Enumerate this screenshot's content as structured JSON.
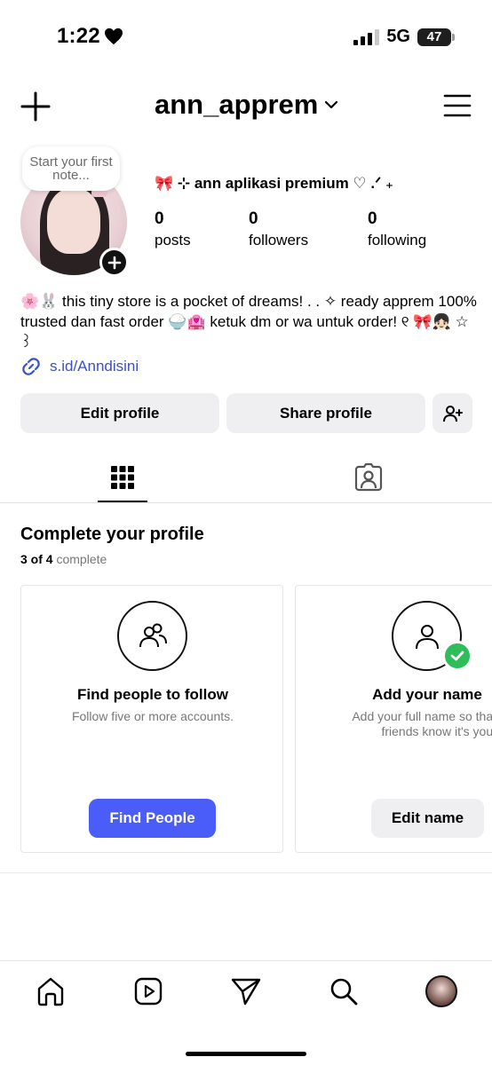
{
  "status_bar": {
    "time": "1:22",
    "network": "5G",
    "battery": "47"
  },
  "header": {
    "username": "ann_apprem"
  },
  "profile": {
    "note": "Start your first note...",
    "display_name": "🎀 ⊹ ann aplikasi premium ♡ .ᐟ ₊",
    "stats": [
      {
        "value": "0",
        "label": "posts"
      },
      {
        "value": "0",
        "label": "followers"
      },
      {
        "value": "0",
        "label": "following"
      }
    ],
    "bio": "🌸🐰 this tiny store is a pocket of dreams! . . ✧ ready apprem 100% trusted dan fast order 🍚🏩 ketuk dm or wa untuk order! ୧ 🎀👧🏻 ☆ ꒱",
    "link": "s.id/Anndisini"
  },
  "actions": {
    "edit": "Edit profile",
    "share": "Share profile"
  },
  "complete_profile": {
    "title": "Complete your profile",
    "progress_bold": "3 of 4",
    "progress_rest": "complete",
    "cards": [
      {
        "title": "Find people to follow",
        "description": "Follow five or more accounts.",
        "button": "Find People"
      },
      {
        "title": "Add your name",
        "description": "Add your full name so that friends know it's you.",
        "button": "Edit name"
      }
    ]
  },
  "colors": {
    "primary_button": "#4a5df9",
    "link": "#3b50c9",
    "check": "#2ebd59"
  },
  "icons": [
    "plus-icon",
    "chevron-down-icon",
    "menu-icon",
    "link-icon",
    "add-person-icon",
    "grid-icon",
    "tagged-icon",
    "people-icon",
    "person-icon",
    "check-icon",
    "home-icon",
    "reels-icon",
    "send-icon",
    "search-icon"
  ]
}
